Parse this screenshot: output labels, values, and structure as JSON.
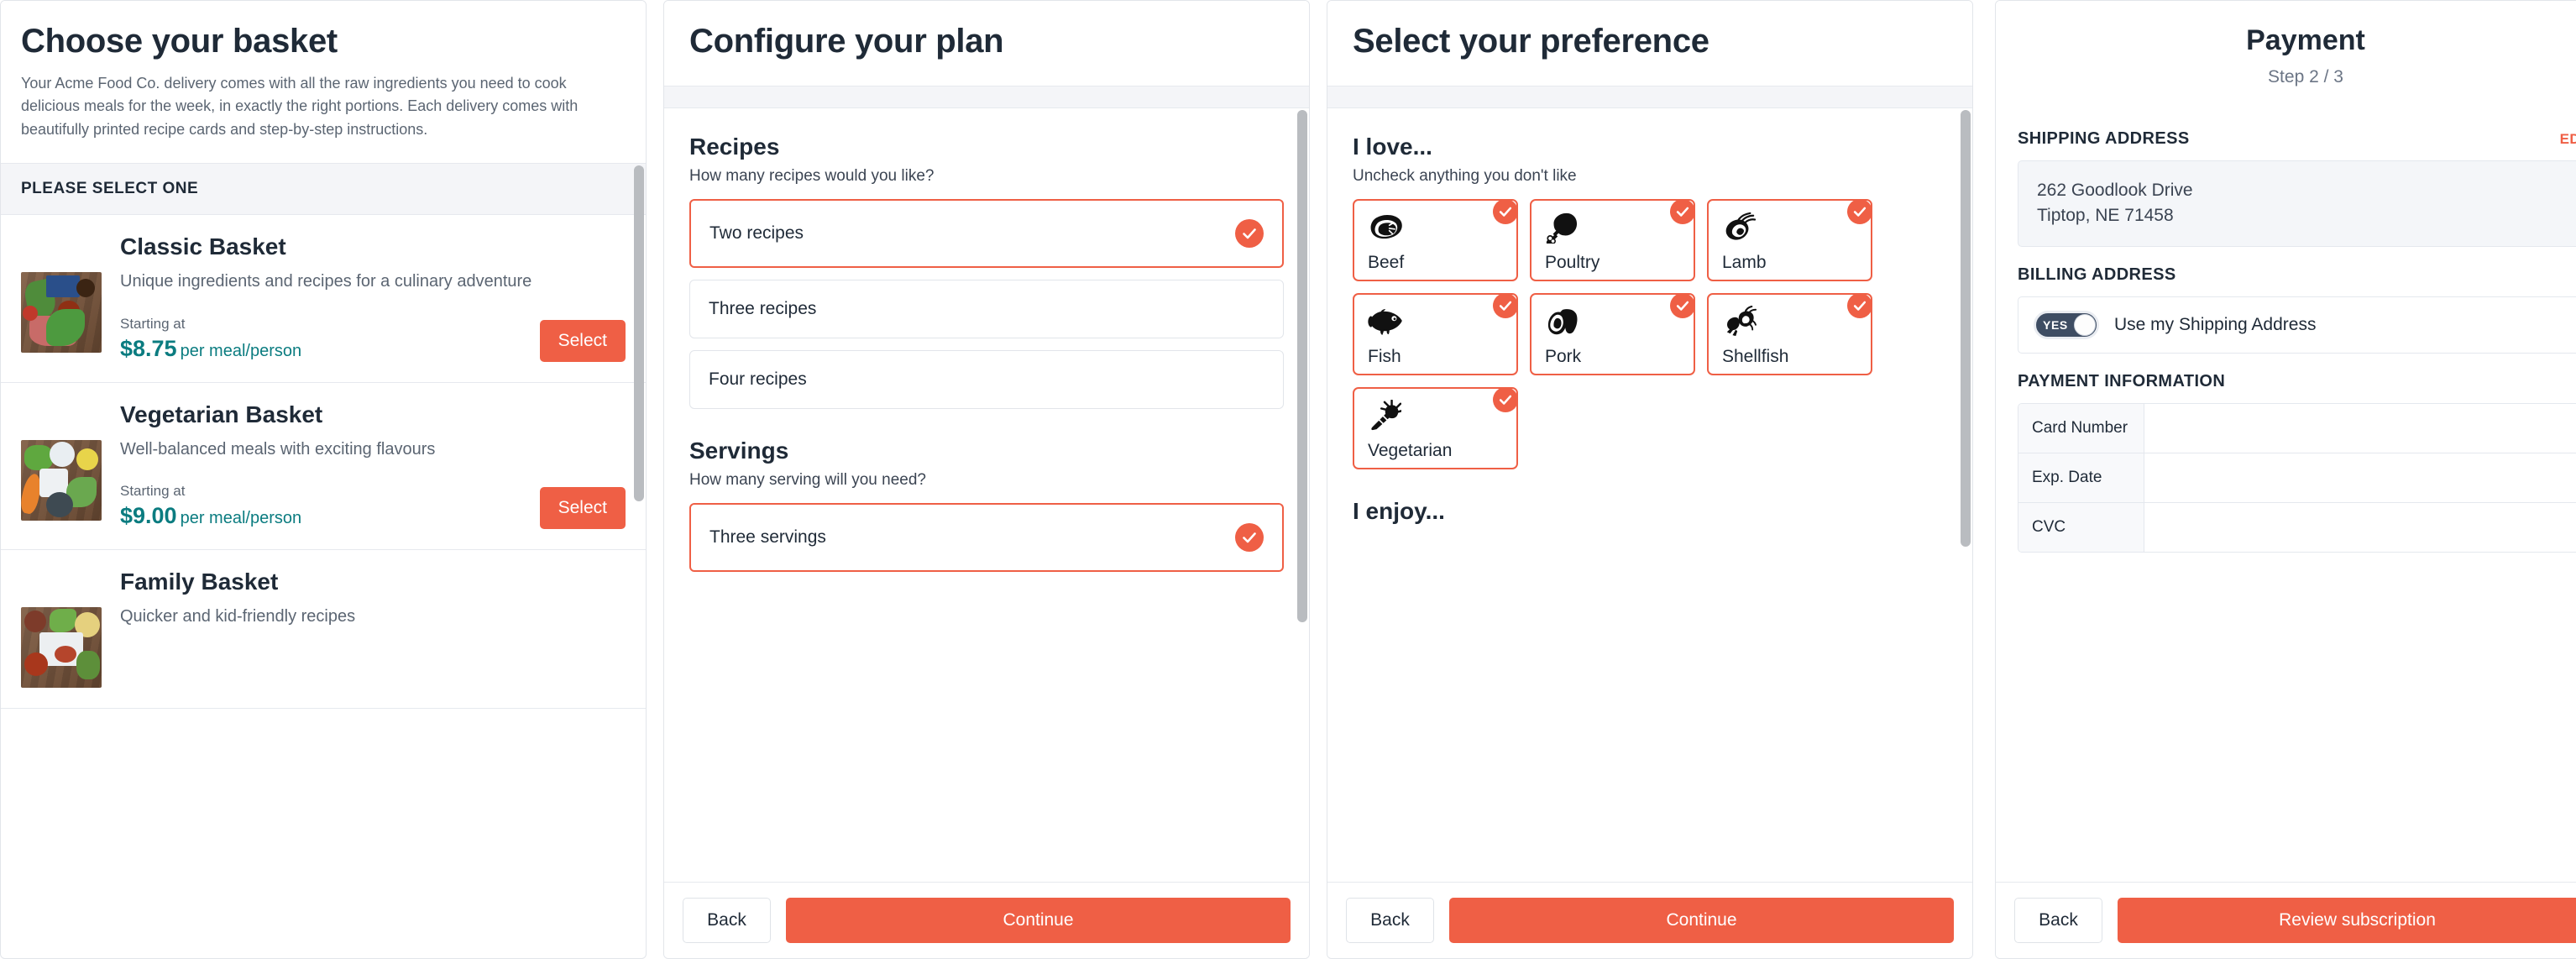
{
  "colors": {
    "accent": "#ef5f45",
    "price_teal": "#0b7c80",
    "heading": "#1f2a37",
    "toggle_on": "#3e4d63"
  },
  "basket_panel": {
    "title": "Choose your basket",
    "intro": "Your Acme Food Co. delivery comes with all the raw ingredients you need to cook delicious meals for the week, in exactly the right portions. Each delivery comes with beautifully printed recipe cards and step-by-step instructions.",
    "select_bar": "PLEASE SELECT ONE",
    "starting_at_label": "Starting at",
    "select_button": "Select",
    "items": [
      {
        "name": "Classic Basket",
        "desc": "Unique ingredients and recipes for a culinary adventure",
        "price": "$8.75",
        "unit": "per meal/person"
      },
      {
        "name": "Vegetarian Basket",
        "desc": "Well-balanced meals with exciting flavours",
        "price": "$9.00",
        "unit": "per meal/person"
      },
      {
        "name": "Family Basket",
        "desc": "Quicker and kid-friendly recipes",
        "price": "",
        "unit": ""
      }
    ]
  },
  "plan_panel": {
    "title": "Configure your plan",
    "recipes": {
      "heading": "Recipes",
      "question": "How many recipes would you like?",
      "options": [
        {
          "label": "Two recipes",
          "selected": true
        },
        {
          "label": "Three recipes",
          "selected": false
        },
        {
          "label": "Four recipes",
          "selected": false
        }
      ]
    },
    "servings": {
      "heading": "Servings",
      "question": "How many serving will you need?",
      "options": [
        {
          "label": "Three servings",
          "selected": true
        }
      ]
    },
    "footer": {
      "back": "Back",
      "continue": "Continue"
    }
  },
  "pref_panel": {
    "title": "Select your preference",
    "love": {
      "heading": "I love...",
      "subtitle": "Uncheck anything you don't like",
      "tiles": [
        {
          "label": "Beef",
          "icon": "steak-icon",
          "checked": true
        },
        {
          "label": "Poultry",
          "icon": "drumstick-icon",
          "checked": true
        },
        {
          "label": "Lamb",
          "icon": "lamb-chop-icon",
          "checked": true
        },
        {
          "label": "Fish",
          "icon": "fish-icon",
          "checked": true
        },
        {
          "label": "Pork",
          "icon": "ham-icon",
          "checked": true
        },
        {
          "label": "Shellfish",
          "icon": "lobster-icon",
          "checked": true
        },
        {
          "label": "Vegetarian",
          "icon": "carrot-icon",
          "checked": true
        }
      ]
    },
    "enjoy": {
      "heading": "I enjoy..."
    },
    "footer": {
      "back": "Back",
      "continue": "Continue"
    }
  },
  "payment_panel": {
    "title": "Payment",
    "step": "Step 2 / 3",
    "shipping": {
      "title": "SHIPPING ADDRESS",
      "edit": "EDIT",
      "line1": "262 Goodlook Drive",
      "line2": "Tiptop, NE 71458"
    },
    "billing": {
      "title": "BILLING ADDRESS",
      "toggle_value": "YES",
      "label": "Use my Shipping Address"
    },
    "payment_information": {
      "title": "PAYMENT INFORMATION",
      "rows": [
        {
          "label": "Card Number",
          "value": ""
        },
        {
          "label": "Exp. Date",
          "value": ""
        },
        {
          "label": "CVC",
          "value": ""
        }
      ]
    },
    "footer": {
      "back": "Back",
      "review": "Review subscription"
    }
  }
}
